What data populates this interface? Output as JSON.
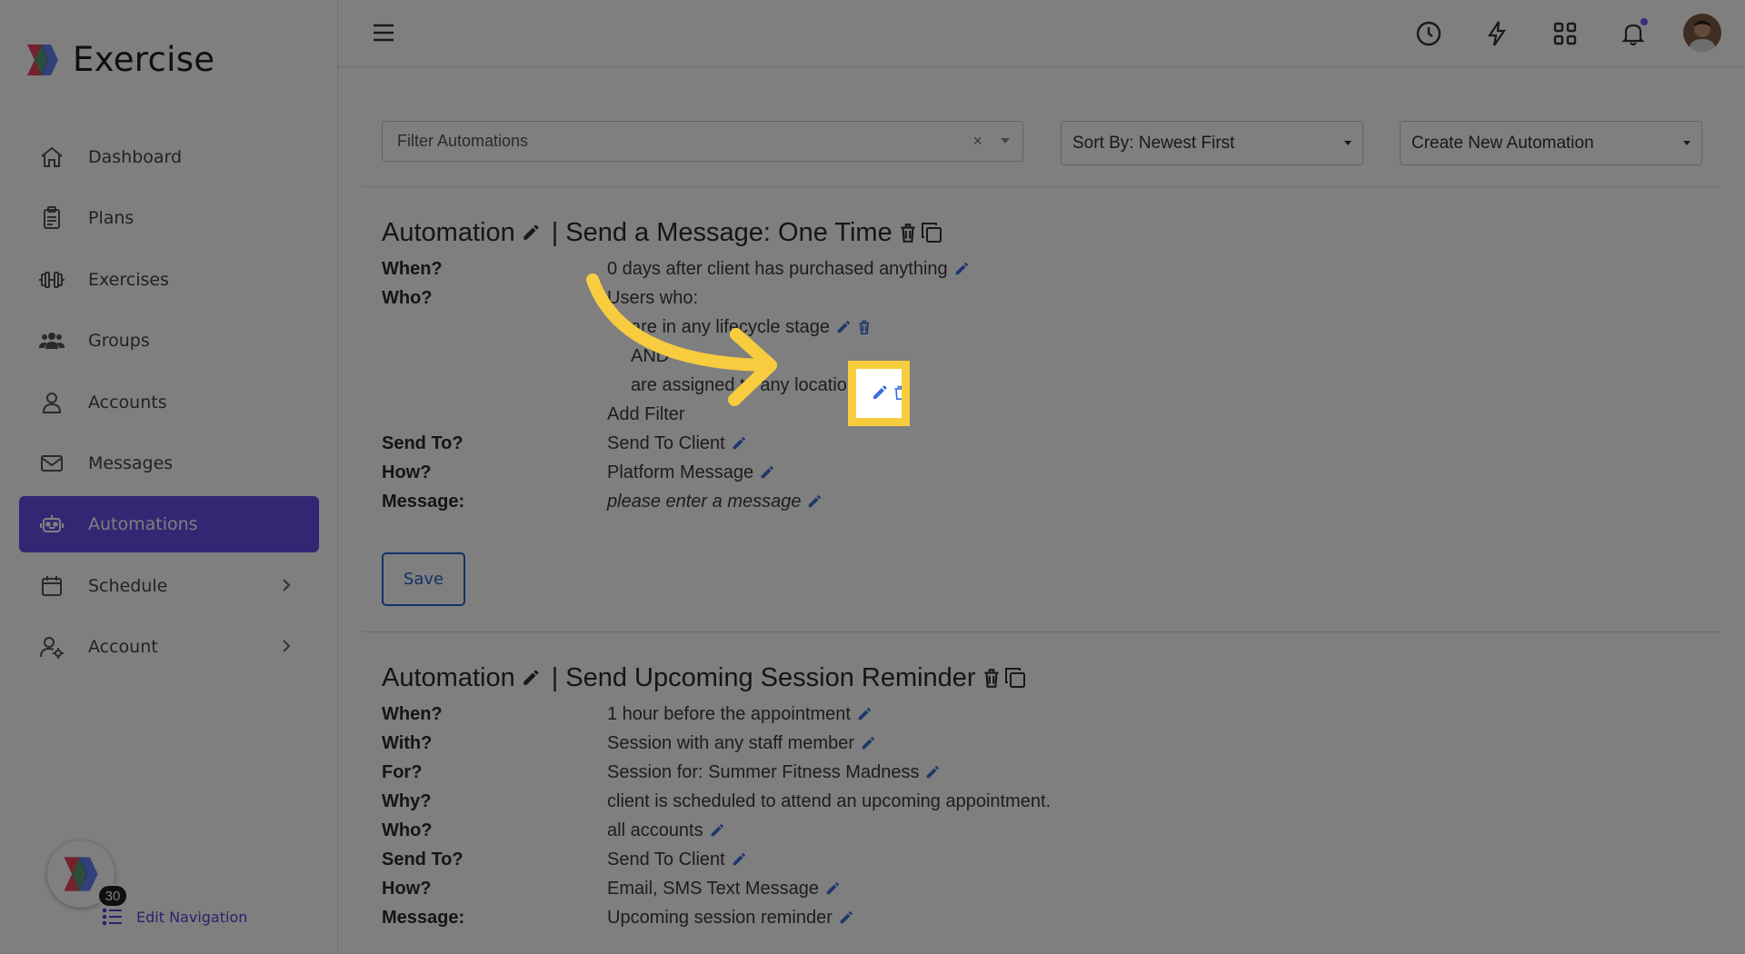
{
  "brand": {
    "name": "Exercise"
  },
  "sidebar": {
    "items": [
      {
        "label": "Dashboard",
        "icon": "home-icon"
      },
      {
        "label": "Plans",
        "icon": "clipboard-icon"
      },
      {
        "label": "Exercises",
        "icon": "dumbbell-icon"
      },
      {
        "label": "Groups",
        "icon": "users-icon"
      },
      {
        "label": "Accounts",
        "icon": "user-icon"
      },
      {
        "label": "Messages",
        "icon": "envelope-icon"
      },
      {
        "label": "Automations",
        "icon": "robot-icon",
        "active": true
      },
      {
        "label": "Schedule",
        "icon": "calendar-icon",
        "expandable": true
      },
      {
        "label": "Account",
        "icon": "user-gear-icon",
        "expandable": true
      }
    ],
    "badge_count": "30",
    "edit_navigation": "Edit Navigation"
  },
  "toolbar": {
    "filter_placeholder": "Filter Automations",
    "filter_clear": "×",
    "sort_label": "Sort By: Newest First",
    "create_label": "Create New Automation"
  },
  "automation1": {
    "title_prefix": "Automation",
    "title_sep": "|",
    "title_name": "Send a Message: One Time",
    "when_label": "When?",
    "when_value": "0 days after client has purchased anything",
    "who_label": "Who?",
    "who_value": "Users who:",
    "filter1": "are in any lifecycle stage",
    "and_label": "AND",
    "filter2": "are assigned to any location",
    "add_filter": "Add Filter",
    "send_to_label": "Send To?",
    "send_to_value": "Send To Client",
    "how_label": "How?",
    "how_value": "Platform Message",
    "message_label": "Message:",
    "message_value": "please enter a message",
    "save_label": "Save"
  },
  "automation2": {
    "title_prefix": "Automation",
    "title_sep": "|",
    "title_name": "Send Upcoming Session Reminder",
    "when_label": "When?",
    "when_value": "1 hour before the appointment",
    "with_label": "With?",
    "with_value": "Session with any staff member",
    "for_label": "For?",
    "for_value": "Session for: Summer Fitness Madness",
    "why_label": "Why?",
    "why_value": "client is scheduled to attend an upcoming appointment.",
    "who_label": "Who?",
    "who_value": "all accounts",
    "send_to_label": "Send To?",
    "send_to_value": "Send To Client",
    "how_label": "How?",
    "how_value": "Email, SMS Text Message",
    "message_label": "Message:",
    "message_value": "Upcoming session reminder"
  },
  "colors": {
    "accent": "#6a4ce8",
    "link": "#3b6fd6",
    "highlight": "#f7cd3f"
  }
}
